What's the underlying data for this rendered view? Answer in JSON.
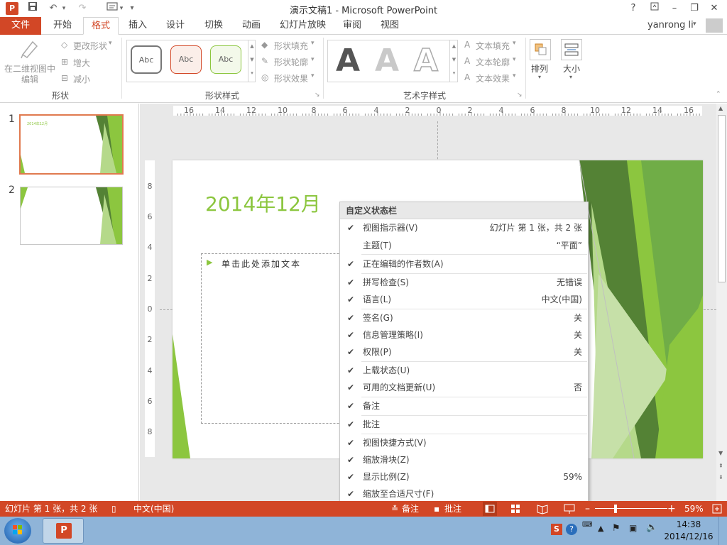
{
  "window": {
    "title": "演示文稿1 - Microsoft PowerPoint",
    "user": "yanrong li",
    "help": "?"
  },
  "tabs": [
    "文件",
    "开始",
    "格式",
    "插入",
    "设计",
    "切换",
    "动画",
    "幻灯片放映",
    "审阅",
    "视图"
  ],
  "ribbon": {
    "shapes_group": {
      "edit_in_2d": "在二维视图中编辑",
      "change_shape": "更改形状",
      "larger": "增大",
      "smaller": "减小",
      "label": "形状"
    },
    "shape_styles": {
      "abc": [
        "Abc",
        "Abc",
        "Abc"
      ],
      "fill": "形状填充",
      "outline": "形状轮廓",
      "effects": "形状效果",
      "label": "形状样式"
    },
    "wordart": {
      "letters": [
        "A",
        "A",
        "A"
      ],
      "text_fill": "文本填充",
      "text_outline": "文本轮廓",
      "text_effects": "文本效果",
      "label": "艺术字样式"
    },
    "arrange": "排列",
    "size": "大小"
  },
  "slides_panel": {
    "numbers": [
      "1",
      "2"
    ],
    "thumb1_title": "2014年12月"
  },
  "ruler_h": [
    "16",
    "14",
    "12",
    "10",
    "8",
    "6",
    "4",
    "2",
    "0",
    "2",
    "4",
    "6",
    "8",
    "10",
    "12",
    "14",
    "16"
  ],
  "ruler_v": [
    "8",
    "6",
    "4",
    "2",
    "0",
    "2",
    "4",
    "6",
    "8"
  ],
  "slide": {
    "title": "2014年12月",
    "bullet": "单击此处添加文本"
  },
  "context_menu": {
    "header": "自定义状态栏",
    "items": [
      {
        "label": "视图指示器(V)",
        "value": "幻灯片 第 1 张，共 2 张",
        "checked": "✔"
      },
      {
        "label": "主题(T)",
        "value": "“平面”",
        "checked": ""
      },
      {
        "label": "正在编辑的作者数(A)",
        "value": "",
        "checked": "✔"
      },
      {
        "label": "拼写检查(S)",
        "value": "无错误",
        "checked": "✔"
      },
      {
        "label": "语言(L)",
        "value": "中文(中国)",
        "checked": "✔"
      },
      {
        "label": "签名(G)",
        "value": "关",
        "checked": "✔"
      },
      {
        "label": "信息管理策略(I)",
        "value": "关",
        "checked": "✔"
      },
      {
        "label": "权限(P)",
        "value": "关",
        "checked": "✔"
      },
      {
        "label": "上载状态(U)",
        "value": "",
        "checked": "✔"
      },
      {
        "label": "可用的文档更新(U)",
        "value": "否",
        "checked": "✔"
      },
      {
        "label": "备注",
        "value": "",
        "checked": "✔"
      },
      {
        "label": "批注",
        "value": "",
        "checked": "✔"
      },
      {
        "label": "视图快捷方式(V)",
        "value": "",
        "checked": "✔"
      },
      {
        "label": "缩放滑块(Z)",
        "value": "",
        "checked": "✔"
      },
      {
        "label": "显示比例(Z)",
        "value": "59%",
        "checked": "✔"
      },
      {
        "label": "缩放至合适尺寸(F)",
        "value": "",
        "checked": "✔"
      }
    ]
  },
  "status": {
    "slide_info": "幻灯片 第 1 张，共 2 张",
    "language": "中文(中国)",
    "notes": "备注",
    "comments": "批注",
    "zoom": "59%"
  },
  "taskbar": {
    "time": "14:38",
    "date": "2014/12/16"
  },
  "colors": {
    "accent": "#d24726",
    "green": "#8cc63f",
    "dark_green": "#548235"
  }
}
